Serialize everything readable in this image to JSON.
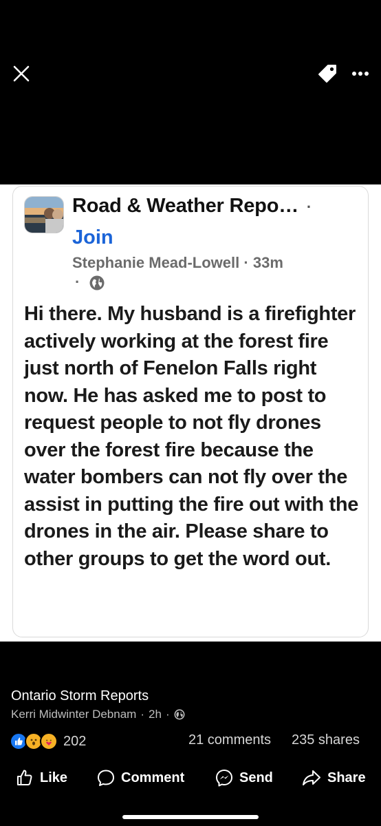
{
  "post": {
    "group_name": "Road & Weather Repo…",
    "group_name_sep": "·",
    "join_label": "Join",
    "author": "Stephanie Mead-Lowell",
    "time": "33m",
    "dot": "·",
    "privacy_icon": "globe-icon",
    "body": "Hi there. My husband is a firefighter actively working at the forest fire just north of Fenelon Falls right now. He has asked me to post to request people to not fly drones over the forest fire because the water bombers can not fly over the assist in putting the fire out with the drones in the air. Please share to other groups to get the word out."
  },
  "footer": {
    "page_name": "Ontario Storm Reports",
    "poster": "Kerri Midwinter Debnam",
    "time": "2h",
    "reaction_count": "202",
    "comments": "21 comments",
    "shares": "235 shares"
  },
  "actions": {
    "like": "Like",
    "comment": "Comment",
    "send": "Send",
    "share": "Share"
  },
  "icons": {
    "close": "close-icon",
    "tag": "tag-icon",
    "more": "more-icon"
  },
  "colors": {
    "join": "#1b64d8",
    "like_reaction": "#1877f2",
    "wow_reaction": "#f7b125"
  }
}
